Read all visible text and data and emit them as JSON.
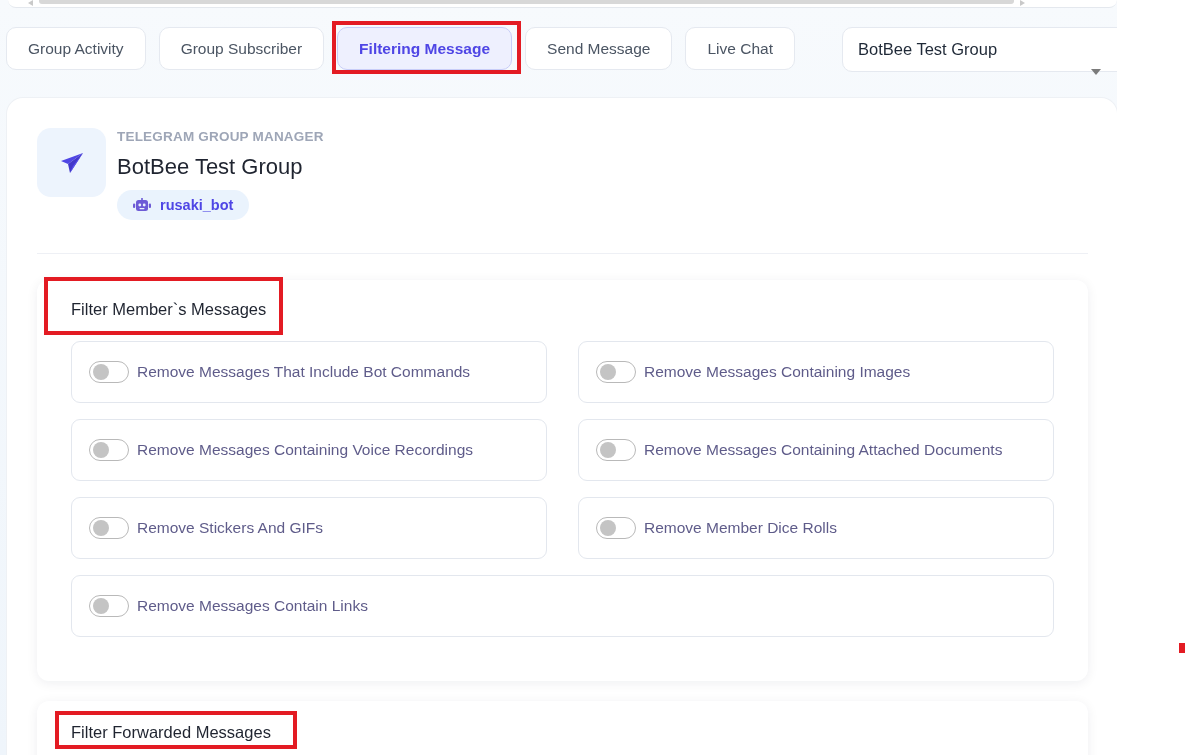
{
  "tabs": [
    {
      "label": "Group Activity",
      "selected": false,
      "annotated": false
    },
    {
      "label": "Group Subscriber",
      "selected": false,
      "annotated": false
    },
    {
      "label": "Filtering Message",
      "selected": true,
      "annotated": true
    },
    {
      "label": "Send Message",
      "selected": false,
      "annotated": false
    },
    {
      "label": "Live Chat",
      "selected": false,
      "annotated": false
    }
  ],
  "group_select": {
    "value": "BotBee Test Group"
  },
  "header": {
    "overline": "TELEGRAM GROUP MANAGER",
    "title": "BotBee Test Group",
    "bot": "rusaki_bot"
  },
  "sections": [
    {
      "title": "Filter Member`s Messages",
      "annotated": true,
      "options": [
        {
          "label": "Remove Messages That Include Bot Commands",
          "on": false
        },
        {
          "label": "Remove Messages Containing Images",
          "on": false
        },
        {
          "label": "Remove Messages Containing Voice Recordings",
          "on": false
        },
        {
          "label": "Remove Messages Containing Attached Documents",
          "on": false
        },
        {
          "label": "Remove Stickers And GIFs",
          "on": false
        },
        {
          "label": "Remove Member Dice Rolls",
          "on": false
        },
        {
          "label": "Remove Messages Contain Links",
          "on": false
        }
      ]
    },
    {
      "title": "Filter Forwarded Messages",
      "annotated": true
    }
  ]
}
